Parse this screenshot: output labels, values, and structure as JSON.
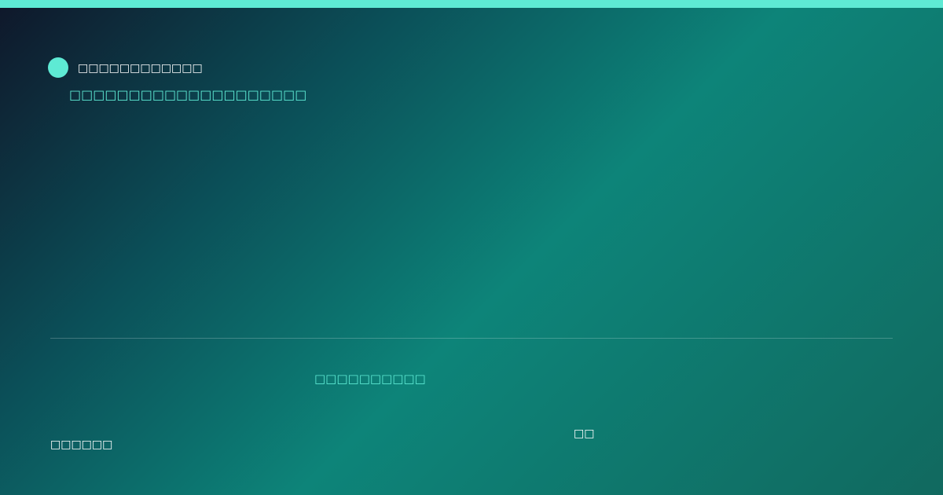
{
  "header": {
    "brand_name": "□□□□□□□□□□□□",
    "subtitle": "□□□□□□□□□□□□□□□□□□□□"
  },
  "main": {
    "tagline": "□□□□□□□□□□"
  },
  "footer": {
    "left_text": "□□□□□□",
    "right_text": "□□"
  },
  "colors": {
    "accent": "#5eead4",
    "text": "#ffffff",
    "background_start": "#0f172a",
    "background_mid": "#0d8479",
    "background_end": "#11695f"
  }
}
